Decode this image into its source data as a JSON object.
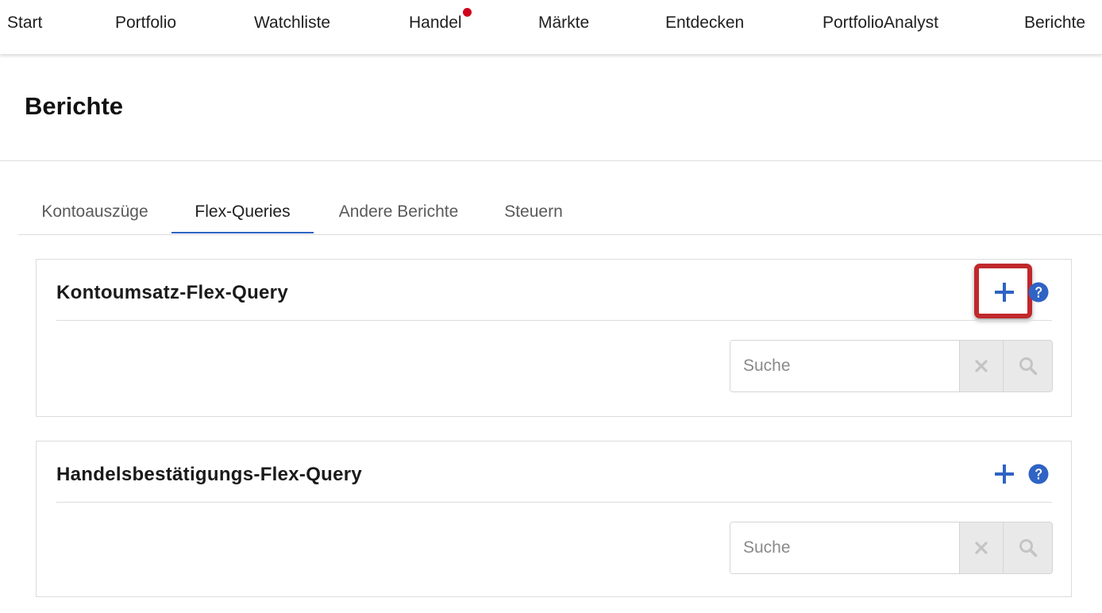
{
  "nav": {
    "items": [
      {
        "label": "Start"
      },
      {
        "label": "Portfolio"
      },
      {
        "label": "Watchliste"
      },
      {
        "label": "Handel",
        "notification": true
      },
      {
        "label": "Märkte"
      },
      {
        "label": "Entdecken"
      },
      {
        "label": "PortfolioAnalyst"
      },
      {
        "label": "Berichte"
      }
    ]
  },
  "page": {
    "title": "Berichte"
  },
  "tabs": [
    {
      "label": "Kontoauszüge",
      "active": false
    },
    {
      "label": "Flex-Queries",
      "active": true
    },
    {
      "label": "Andere Berichte",
      "active": false
    },
    {
      "label": "Steuern",
      "active": false
    }
  ],
  "panels": [
    {
      "title": "Kontoumsatz-Flex-Query",
      "add_icon": "plus-icon",
      "help_icon": "question-circle-icon",
      "add_highlighted": true,
      "search": {
        "placeholder": "Suche",
        "value": ""
      }
    },
    {
      "title": "Handelsbestätigungs-Flex-Query",
      "add_icon": "plus-icon",
      "help_icon": "question-circle-icon",
      "add_highlighted": false,
      "search": {
        "placeholder": "Suche",
        "value": ""
      }
    }
  ],
  "colors": {
    "accent": "#2f63c4",
    "notification": "#d0021b",
    "highlight": "#c0282c",
    "icon_disabled": "#c4c4c4"
  }
}
